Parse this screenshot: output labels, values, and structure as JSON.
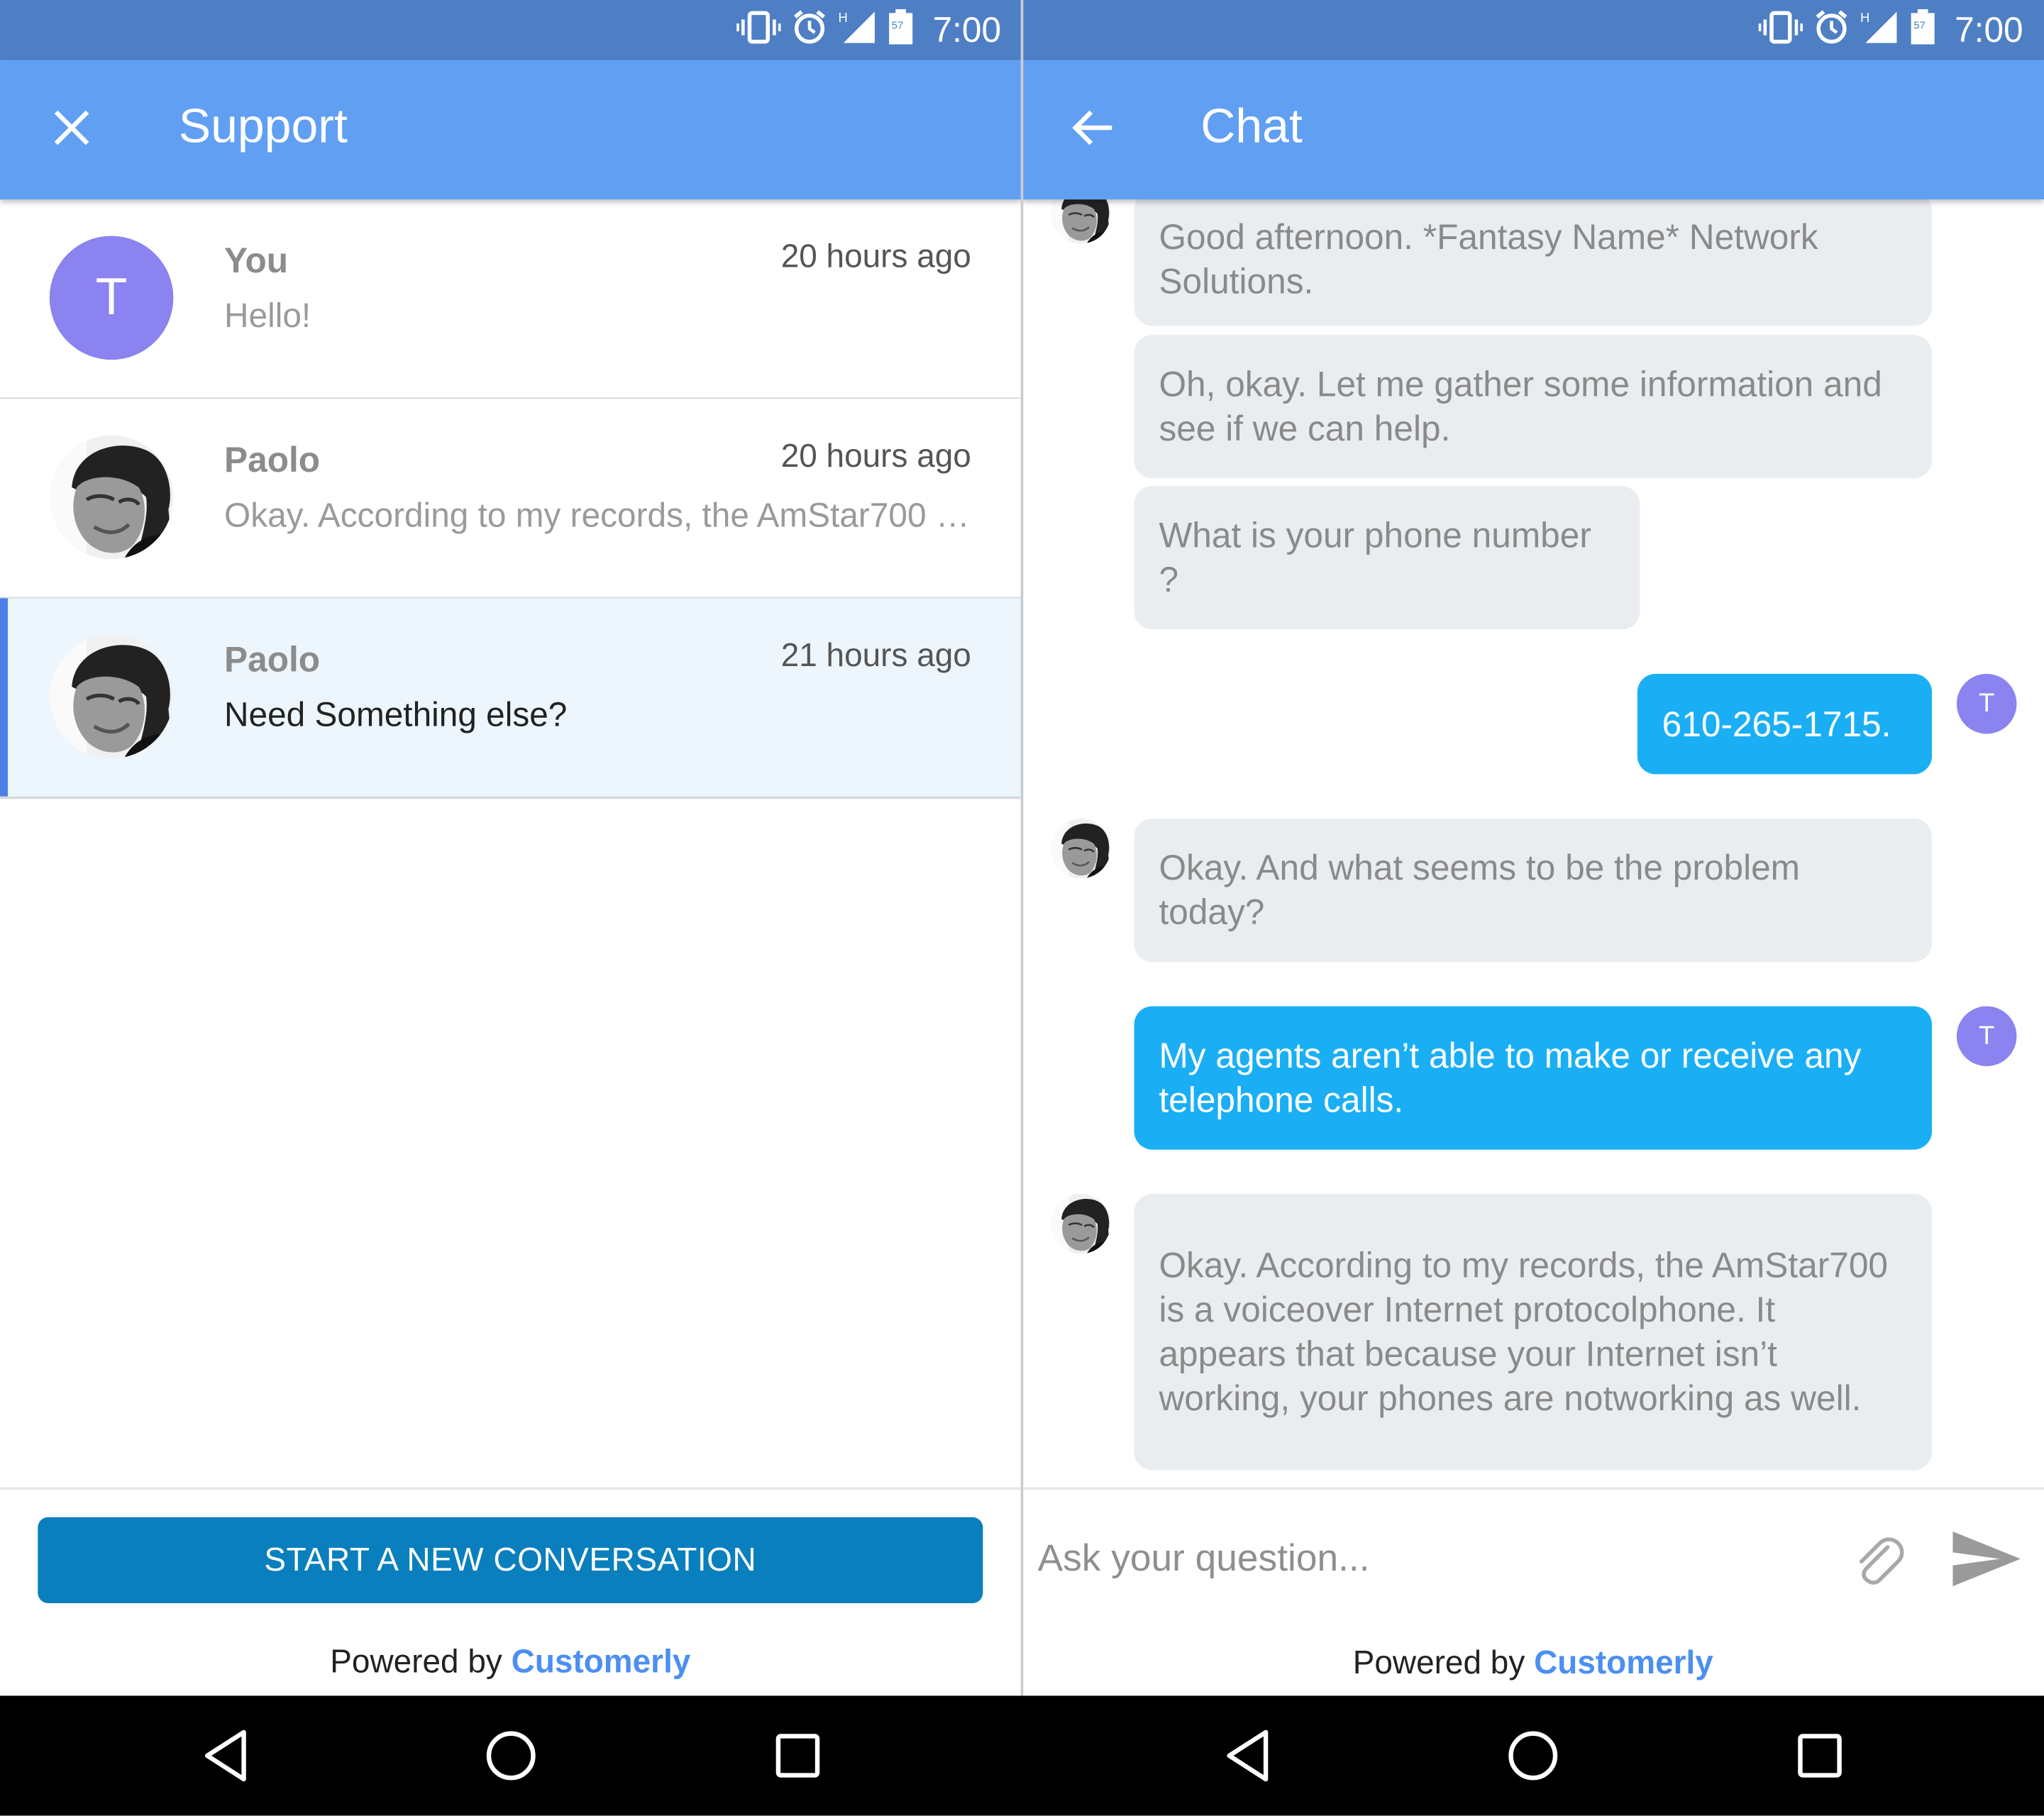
{
  "status_bar": {
    "time": "7:00",
    "icons": [
      "vibrate-icon",
      "alarm-icon",
      "signal-h-icon",
      "battery-icon"
    ]
  },
  "support": {
    "title": "Support",
    "close_icon": "close-icon",
    "conversations": [
      {
        "avatar_letter": "T",
        "name": "You",
        "time": "20 hours ago",
        "message": "Hello!"
      },
      {
        "name": "Paolo",
        "time": "20 hours ago",
        "message": "Okay. According to my records, the AmStar700 is a voiceover Internet protocolphone. It appears that because your Internet isn’t working, your phones are notworking as well."
      },
      {
        "name": "Paolo",
        "time": "21 hours ago",
        "message": "Need Something else?",
        "selected": true
      }
    ],
    "new_conversation_label": "START A NEW CONVERSATION",
    "powered_by": "Powered by",
    "brand": "Customerly"
  },
  "chat": {
    "title": "Chat",
    "back_icon": "arrow-back-icon",
    "messages": [
      {
        "from": "agent",
        "text": "Good afternoon. *Fantasy Name* Network Solutions."
      },
      {
        "from": "agent",
        "text": "Oh, okay. Let me gather some information and see if we can help."
      },
      {
        "from": "agent",
        "text": "What is your phone number ?"
      },
      {
        "from": "user",
        "avatar_letter": "T",
        "text": "610-265-1715."
      },
      {
        "from": "agent",
        "text": "Okay. And what seems to be the problem today?"
      },
      {
        "from": "user",
        "avatar_letter": "T",
        "text": "My agents aren’t able to make or receive any telephone calls."
      },
      {
        "from": "agent",
        "text": "Okay. According to my records, the AmStar700 is a voiceover Internet protocolphone. It appears that because your Internet isn’t working, your phones are notworking as well."
      }
    ],
    "input_placeholder": "Ask your question...",
    "attach_icon": "paperclip-icon",
    "send_icon": "send-icon",
    "powered_by": "Powered by",
    "brand": "Customerly"
  },
  "nav_bar": {
    "icons": [
      "back-triangle-icon",
      "home-circle-icon",
      "recents-square-icon"
    ]
  },
  "colors": {
    "status_bar": "#4e7fc4",
    "app_bar": "#619ff3",
    "user_bubble": "#1aaff5",
    "agent_bubble": "#eaedf0",
    "button": "#0a7fbd",
    "avatar": "#8b83ef",
    "brand": "#4c8ff0"
  }
}
